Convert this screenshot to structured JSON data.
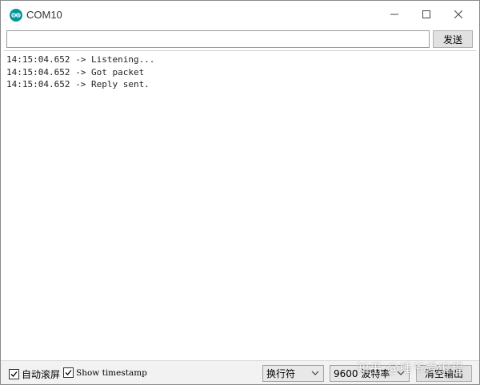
{
  "window": {
    "title": "COM10",
    "app_icon": "arduino-icon",
    "controls": [
      "minimize-icon",
      "maximize-icon",
      "close-icon"
    ]
  },
  "input": {
    "value": "",
    "send_label": "发送"
  },
  "output": {
    "lines": [
      "14:15:04.652 -> Listening...",
      "14:15:04.652 -> Got packet",
      "14:15:04.652 -> Reply sent."
    ]
  },
  "bottom": {
    "autoscroll_label": "自动滚屏",
    "autoscroll_checked": true,
    "timestamp_label": "Show timestamp",
    "timestamp_checked": true,
    "line_ending": "换行符",
    "baud_rate": "9600 波特率",
    "clear_label": "清空输出"
  },
  "watermark": "知乎 @睡爷爱编程",
  "colors": {
    "accent": "#00979c"
  }
}
